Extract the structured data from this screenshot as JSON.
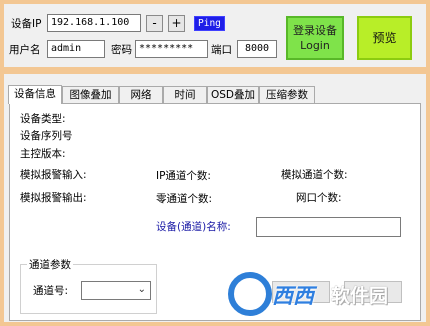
{
  "connection": {
    "ip_label": "设备IP",
    "ip_value": "192.168.1.100",
    "minus_label": "-",
    "plus_label": "+",
    "ping_label": "Ping",
    "user_label": "用户名",
    "user_value": "admin",
    "password_label": "密码",
    "password_value": "*********",
    "port_label": "端口",
    "port_value": "8000",
    "login_line1": "登录设备",
    "login_line2": "Login",
    "preview_label": "预览"
  },
  "tabs": [
    {
      "label": "设备信息"
    },
    {
      "label": "图像叠加"
    },
    {
      "label": "网络"
    },
    {
      "label": "时间"
    },
    {
      "label": "OSD叠加"
    },
    {
      "label": "压缩参数"
    }
  ],
  "device_info": {
    "device_type_label": "设备类型:",
    "serial_label": "设备序列号",
    "firmware_label": "主控版本:",
    "alarm_in_label": "模拟报警输入:",
    "alarm_out_label": "模拟报警输出:",
    "ip_channels_label": "IP通道个数:",
    "zero_channels_label": "零通道个数:",
    "analog_channels_label": "模拟通道个数:",
    "net_ports_label": "网口个数:",
    "channel_name_label": "设备(通道)名称:"
  },
  "channel_params": {
    "group_title": "通道参数",
    "channel_no_label": "通道号:"
  },
  "watermark": {
    "text_blue": "西西",
    "text_white": "软件园"
  },
  "colors": {
    "outer_border": "#f3c793",
    "login_button": "#7fe34a",
    "preview_button": "#b8ee28",
    "ping_button": "#1e1ee8",
    "channel_name_label": "#1a1aa6"
  }
}
